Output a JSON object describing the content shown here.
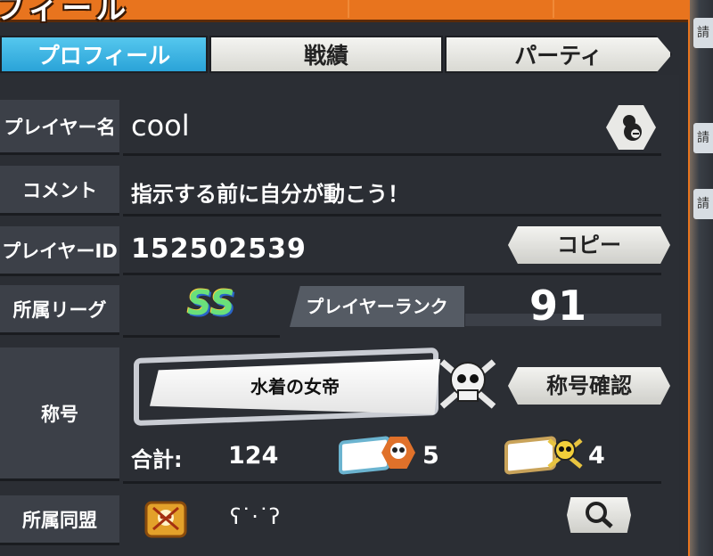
{
  "header": {
    "title": "フィール"
  },
  "tabs": [
    {
      "label": "プロフィール",
      "active": true
    },
    {
      "label": "戦績",
      "active": false
    },
    {
      "label": "パーティ",
      "active": false
    }
  ],
  "side_tabs": [
    "請",
    "請",
    "請"
  ],
  "profile": {
    "player_name_label": "プレイヤー名",
    "player_name": "cool",
    "comment_label": "コメント",
    "comment": "指示する前に自分が動こう！",
    "player_id_label": "プレイヤーID",
    "player_id": "152502539",
    "copy_button": "コピー",
    "league_label": "所属リーグ",
    "league_badge": "SS",
    "rank_label": "プレイヤーランク",
    "rank": "91",
    "title_label": "称号",
    "title_name": "水着の女帝",
    "title_check_button": "称号確認",
    "total_label": "合計:",
    "total": "124",
    "count_a": "5",
    "count_b": "4",
    "alliance_label": "所属同盟",
    "alliance_name": "ʕ˙·˙ʔ"
  },
  "colors": {
    "accent_tab": "#2aa3d8",
    "frame": "#e8741e",
    "panel": "#2b2e34"
  },
  "icons": [
    "profile-icon",
    "search-icon",
    "skull-icon",
    "flag-icon",
    "hex-skull-icon"
  ]
}
